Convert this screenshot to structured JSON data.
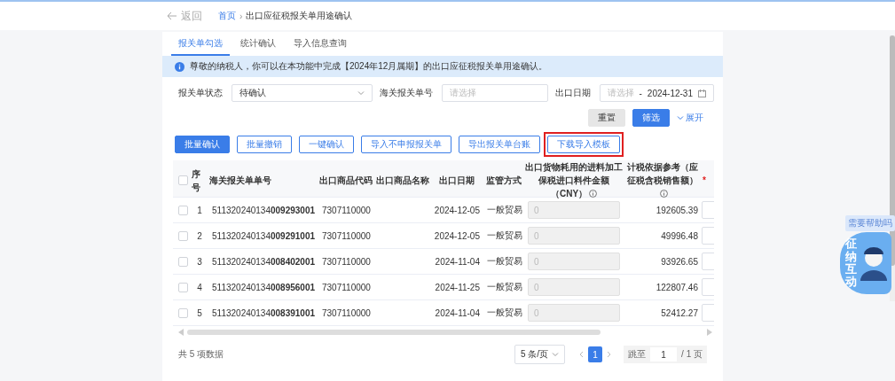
{
  "header": {
    "back": "返回",
    "separator": "›",
    "breadcrumb": [
      {
        "label": "首页",
        "link": true
      },
      {
        "label": "出口应征税报关单用途确认",
        "link": false
      }
    ]
  },
  "tabs": [
    {
      "label": "报关单勾选",
      "selected": true
    },
    {
      "label": "统计确认",
      "selected": false
    },
    {
      "label": "导入信息查询",
      "selected": false
    }
  ],
  "notice": "尊敬的纳税人，你可以在本功能中完成【2024年12月属期】的出口应征税报关单用途确认。",
  "filters": [
    {
      "kind": "select",
      "label": "报关单状态",
      "value": "待确认"
    },
    {
      "kind": "input",
      "label": "海关报关单号",
      "placeholder": "请选择"
    },
    {
      "kind": "daterange",
      "label": "出口日期",
      "placeholder": "请选择",
      "separator": "-",
      "value": "2024-12-31"
    }
  ],
  "filter_actions": {
    "reset": "重置",
    "search": "筛选",
    "expand": "展开"
  },
  "actions": [
    {
      "label": "批量确认",
      "primary": true,
      "highlighted": false
    },
    {
      "label": "批量撤销",
      "primary": false,
      "highlighted": false
    },
    {
      "label": "一键确认",
      "primary": false,
      "highlighted": false
    },
    {
      "label": "导入不申报报关单",
      "primary": false,
      "highlighted": false
    },
    {
      "label": "导出报关单台账",
      "primary": false,
      "highlighted": false
    },
    {
      "label": "下载导入模板",
      "primary": false,
      "highlighted": true
    }
  ],
  "table": {
    "header_checked": false,
    "columns": [
      {
        "label": "序号",
        "info": false
      },
      {
        "label": "海关报关单单号",
        "info": false
      },
      {
        "label": "出口商品代码",
        "info": false
      },
      {
        "label": "出口商品名称",
        "info": false
      },
      {
        "label": "出口日期",
        "info": false
      },
      {
        "label": "监管方式",
        "info": false
      },
      {
        "label": "出口货物耗用的进料加工保税进口料件金额（CNY）",
        "info": true
      },
      {
        "label": "计税依据参考（应征税含税销售额）",
        "info": true
      },
      {
        "label": "*",
        "info": false,
        "kind": "required"
      }
    ],
    "rows": [
      {
        "checked": false,
        "index": "1",
        "number": "511320240134**009293001**",
        "code": "7307110000",
        "date": "2024-12-05",
        "mode": "一般贸易",
        "amount": "0",
        "reference": "192605.39"
      },
      {
        "checked": false,
        "index": "2",
        "number": "511320240134**009291001**",
        "code": "7307110000",
        "date": "2024-12-05",
        "mode": "一般贸易",
        "amount": "0",
        "reference": "49996.48"
      },
      {
        "checked": false,
        "index": "3",
        "number": "511320240134**008402001**",
        "code": "7307110000",
        "date": "2024-11-04",
        "mode": "一般贸易",
        "amount": "0",
        "reference": "93926.65"
      },
      {
        "checked": false,
        "index": "4",
        "number": "511320240134**008956001**",
        "code": "7307110000",
        "date": "2024-11-25",
        "mode": "一般贸易",
        "amount": "0",
        "reference": "122807.46"
      },
      {
        "checked": false,
        "index": "5",
        "number": "511320240134**008391001**",
        "code": "7307110000",
        "date": "2024-11-04",
        "mode": "一般贸易",
        "amount": "0",
        "reference": "52412.27"
      }
    ]
  },
  "pagination": {
    "total": "共 5 项数据",
    "page_size": "5 条/页",
    "pages": [
      {
        "label": "1",
        "selected": true
      }
    ],
    "jump_label": "跳至",
    "jump_value": "1",
    "page_count": "/ 1 页"
  },
  "help": {
    "bubble": "需要帮助吗",
    "badge": "征纳互动"
  }
}
